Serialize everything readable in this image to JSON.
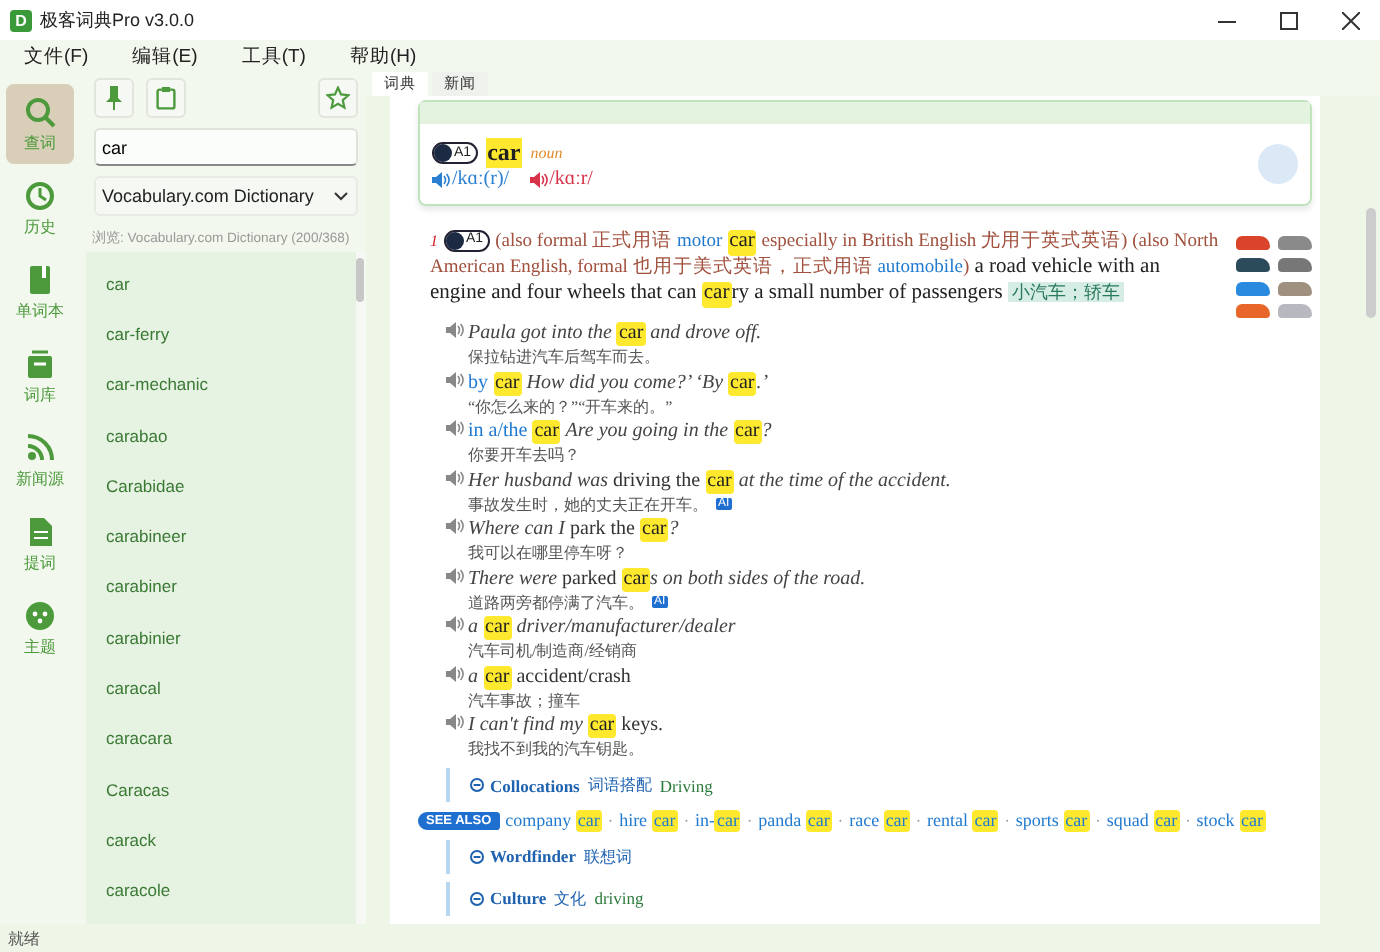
{
  "window": {
    "icon_letter": "D",
    "title": "极客词典Pro v3.0.0"
  },
  "menu": [
    "文件(F)",
    "编辑(E)",
    "工具(T)",
    "帮助(H)"
  ],
  "nav": [
    {
      "label": "查词",
      "selected": true
    },
    {
      "label": "历史",
      "selected": false
    },
    {
      "label": "单词本",
      "selected": false
    },
    {
      "label": "词库",
      "selected": false
    },
    {
      "label": "新闻源",
      "selected": false
    },
    {
      "label": "提词",
      "selected": false
    },
    {
      "label": "主题",
      "selected": false
    }
  ],
  "search": {
    "value": "car"
  },
  "dictionary_select": {
    "value": "Vocabulary.com Dictionary"
  },
  "browse_caption": "浏览: Vocabulary.com Dictionary (200/368)",
  "word_list": [
    "car",
    "car-ferry",
    "car-mechanic",
    "carabao",
    "Carabidae",
    "carabineer",
    "carabiner",
    "carabinier",
    "caracal",
    "caracara",
    "Caracas",
    "carack",
    "caracole"
  ],
  "tabs": [
    {
      "label": "词典",
      "selected": true
    },
    {
      "label": "新闻",
      "selected": false
    }
  ],
  "entry": {
    "cefr": "A1",
    "headword": "car",
    "pos": "noun",
    "pron_uk": "/kɑː(r)/",
    "pron_us": "/kɑːr/",
    "sense": {
      "number": "1",
      "cefr": "A1",
      "definition": [
        {
          "kind": "lab",
          "text": "(also formal 正式用语 "
        },
        {
          "kind": "link",
          "text": "motor "
        },
        {
          "kind": "hit",
          "text": "car"
        },
        {
          "kind": "lab",
          "text": " especially in British English 尤用于英式英语) (also North American English, formal 也用于美式英语，正式用语 "
        },
        {
          "kind": "link",
          "text": "automobile"
        },
        {
          "kind": "lab",
          "text": ")"
        },
        {
          "kind": "txt",
          "text": " a road vehicle with an engine and four wheels that can "
        },
        {
          "kind": "hit",
          "text": "car"
        },
        {
          "kind": "txt",
          "text": "ry a small number of passengers"
        }
      ],
      "translation": "小汽车；轿车"
    },
    "examples": [
      {
        "en": [
          {
            "kind": "it",
            "text": "Paula got into the "
          },
          {
            "kind": "hit",
            "text": "car"
          },
          {
            "kind": "it",
            "text": " and drove off."
          }
        ],
        "zh": "保拉钻进汽车后驾车而去。"
      },
      {
        "en": [
          {
            "kind": "phr",
            "text": "by "
          },
          {
            "kind": "hit",
            "text": "car"
          },
          {
            "kind": "it",
            "text": " How did you come?’ ‘By "
          },
          {
            "kind": "hit",
            "text": "car"
          },
          {
            "kind": "it",
            "text": ".’"
          }
        ],
        "zh": "“你怎么来的？”“开车来的。”"
      },
      {
        "en": [
          {
            "kind": "phr",
            "text": "in a/the "
          },
          {
            "kind": "hit",
            "text": "car"
          },
          {
            "kind": "it",
            "text": " Are you going in the "
          },
          {
            "kind": "hit",
            "text": "car"
          },
          {
            "kind": "it",
            "text": "?"
          }
        ],
        "zh": "你要开车去吗？"
      },
      {
        "en": [
          {
            "kind": "it",
            "text": "Her husband was "
          },
          {
            "kind": "rm",
            "text": "driving the "
          },
          {
            "kind": "hit",
            "text": "car"
          },
          {
            "kind": "it",
            "text": " at the time of the accident."
          }
        ],
        "zh": "事故发生时，她的丈夫正在开车。",
        "badge": "AI"
      },
      {
        "en": [
          {
            "kind": "it",
            "text": "Where can I "
          },
          {
            "kind": "rm",
            "text": "park the "
          },
          {
            "kind": "hit",
            "text": "car"
          },
          {
            "kind": "it",
            "text": "?"
          }
        ],
        "zh": "我可以在哪里停车呀？"
      },
      {
        "en": [
          {
            "kind": "it",
            "text": "There were "
          },
          {
            "kind": "rm",
            "text": "parked "
          },
          {
            "kind": "hit",
            "text": "car"
          },
          {
            "kind": "it",
            "text": "s on both sides of the road."
          }
        ],
        "zh": "道路两旁都停满了汽车。",
        "badge": "AI"
      },
      {
        "en": [
          {
            "kind": "it",
            "text": "a "
          },
          {
            "kind": "hit",
            "text": "car"
          },
          {
            "kind": "it",
            "text": " driver/manufacturer/dealer"
          }
        ],
        "zh": "汽车司机/制造商/经销商"
      },
      {
        "en": [
          {
            "kind": "it",
            "text": "a "
          },
          {
            "kind": "hit",
            "text": "car"
          },
          {
            "kind": "rm",
            "text": " accident/crash"
          }
        ],
        "zh": "汽车事故；撞车"
      },
      {
        "en": [
          {
            "kind": "it",
            "text": "I can't find my "
          },
          {
            "kind": "hit",
            "text": "car"
          },
          {
            "kind": "rm",
            "text": " keys."
          }
        ],
        "zh": "我找不到我的汽车钥匙。"
      }
    ],
    "collocations": {
      "label": "Collocations",
      "zh": "词语搭配",
      "topic": "Driving"
    },
    "see_also": {
      "badge": "SEE ALSO",
      "separator": "·",
      "items": [
        {
          "word": "company ",
          "hit": "car"
        },
        {
          "word": "hire ",
          "hit": "car"
        },
        {
          "word": "in-",
          "hit": "car"
        },
        {
          "word": "panda ",
          "hit": "car"
        },
        {
          "word": "race ",
          "hit": "car"
        },
        {
          "word": "rental ",
          "hit": "car"
        },
        {
          "word": "sports ",
          "hit": "car"
        },
        {
          "word": "squad ",
          "hit": "car"
        },
        {
          "word": "stock ",
          "hit": "car"
        }
      ]
    },
    "wordfinder": {
      "label": "Wordfinder",
      "zh": "联想词"
    },
    "culture": {
      "label": "Culture",
      "zh": "文化",
      "topic": "driving"
    }
  },
  "status_bar": "就绪"
}
